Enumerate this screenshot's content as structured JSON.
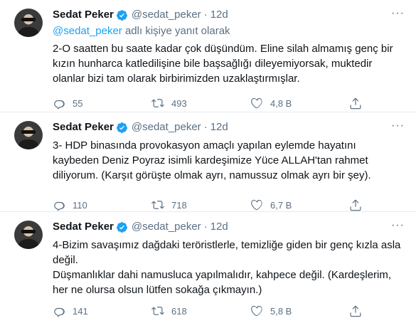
{
  "colors": {
    "accent": "#1da1f2",
    "muted": "#5b7083",
    "text": "#0f1419"
  },
  "tweets": [
    {
      "name": "Sedat Peker",
      "handle": "@sedat_peker",
      "time": "12d",
      "reply_to": "@sedat_peker",
      "reply_suffix": " adlı kişiye yanıt olarak",
      "text": "2-O saatten bu saate kadar çok düşündüm. Eline silah almamış genç bir kızın hunharca katledilişine bile başsağlığı dileyemiyorsak, muktedir olanlar bizi tam olarak birbirimizden uzaklaştırmışlar.",
      "replies": "55",
      "retweets": "493",
      "likes": "4,8 B"
    },
    {
      "name": "Sedat Peker",
      "handle": "@sedat_peker",
      "time": "12d",
      "text": "3- HDP binasında provokasyon amaçlı yapılan eylemde hayatını kaybeden Deniz Poyraz isimli kardeşimize Yüce ALLAH'tan rahmet diliyorum. (Karşıt görüşte olmak ayrı, namussuz olmak ayrı bir şey).",
      "replies": "110",
      "retweets": "718",
      "likes": "6,7 B"
    },
    {
      "name": "Sedat Peker",
      "handle": "@sedat_peker",
      "time": "12d",
      "text": "4-Bizim savaşımız dağdaki teröristlerle, temizliğe giden bir genç kızla asla değil.\nDüşmanlıklar dahi namusluca yapılmalıdır, kahpece değil. (Kardeşlerim, her ne olursa olsun lütfen sokağa çıkmayın.)",
      "replies": "141",
      "retweets": "618",
      "likes": "5,8 B"
    }
  ]
}
